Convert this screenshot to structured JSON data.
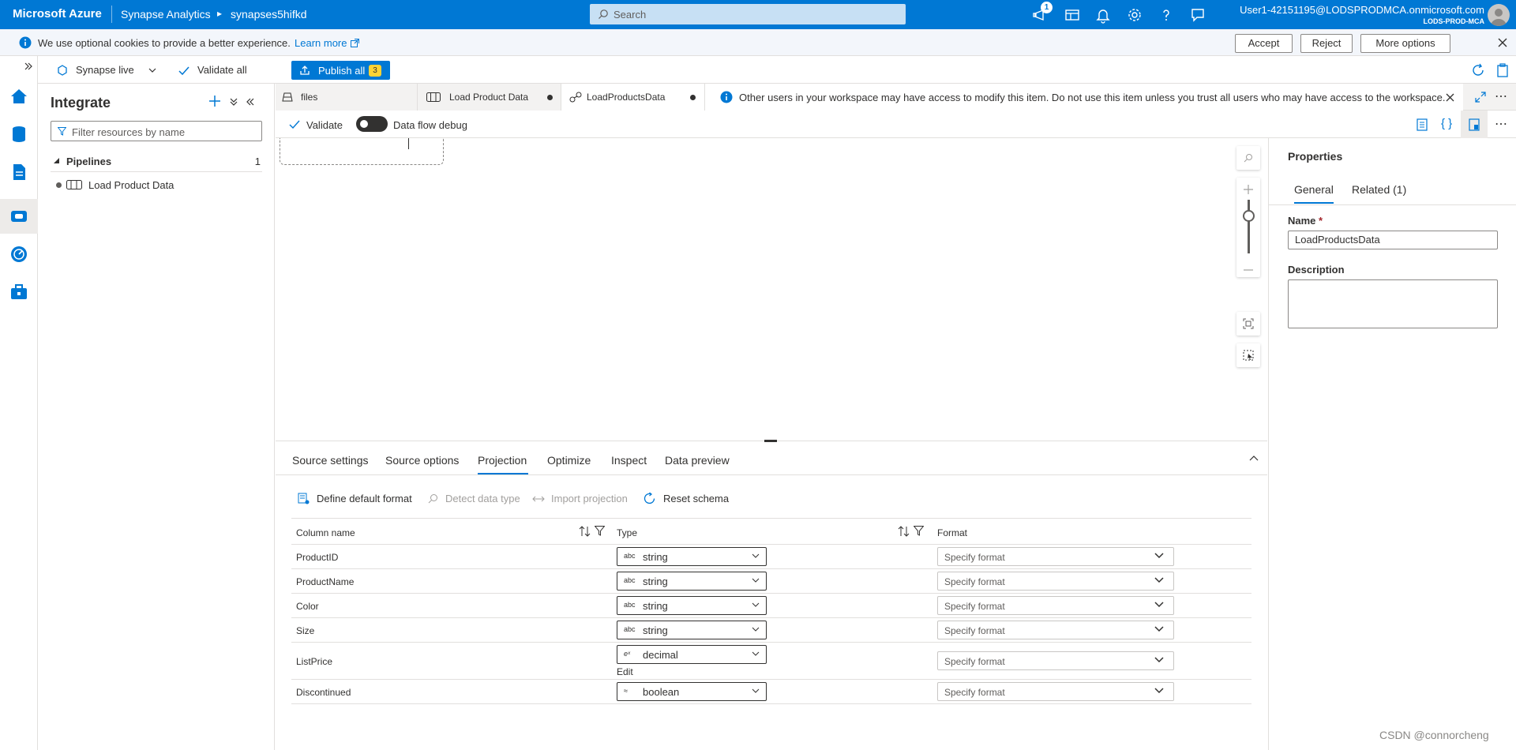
{
  "topbar": {
    "brand": "Microsoft Azure",
    "crumbs": [
      "Synapse Analytics",
      "synapses5hifkd"
    ],
    "search_placeholder": "Search",
    "notification_count": "1",
    "user_name": "User1-42151195@LODSPRODMCA.onmicrosoft.com",
    "user_tenant": "LODS-PROD-MCA"
  },
  "cookie": {
    "message": "We use optional cookies to provide a better experience.",
    "learn_more": "Learn more",
    "accept": "Accept",
    "reject": "Reject",
    "more_options": "More options"
  },
  "toolbar": {
    "synapse_live": "Synapse live",
    "validate_all": "Validate all",
    "publish_all": "Publish all",
    "publish_count": "3"
  },
  "integrate": {
    "title": "Integrate",
    "filter_placeholder": "Filter resources by name",
    "pipelines_label": "Pipelines",
    "pipelines_count": "1",
    "pipeline_item": "Load Product Data"
  },
  "tabs": {
    "files": "files",
    "load_product_data": "Load Product Data",
    "load_products_data": "LoadProductsData",
    "banner": "Other users in your workspace may have access to modify this item. Do not use this item unless you trust all users who may have access to the workspace."
  },
  "editor": {
    "validate": "Validate",
    "debug": "Data flow debug"
  },
  "properties": {
    "title": "Properties",
    "tab_general": "General",
    "tab_related": "Related (1)",
    "name_label": "Name",
    "required_mark": "*",
    "name_value": "LoadProductsData",
    "description_label": "Description"
  },
  "bottom": {
    "tabs": [
      "Source settings",
      "Source options",
      "Projection",
      "Optimize",
      "Inspect",
      "Data preview"
    ],
    "actions": {
      "define_default_format": "Define default format",
      "detect_data_type": "Detect data type",
      "import_projection": "Import projection",
      "reset_schema": "Reset schema"
    },
    "headers": {
      "column_name": "Column name",
      "type": "Type",
      "format": "Format"
    },
    "format_placeholder": "Specify format",
    "edit_link": "Edit",
    "rows": [
      {
        "name": "ProductID",
        "type_icon": "abc",
        "type": "string"
      },
      {
        "name": "ProductName",
        "type_icon": "abc",
        "type": "string"
      },
      {
        "name": "Color",
        "type_icon": "abc",
        "type": "string"
      },
      {
        "name": "Size",
        "type_icon": "abc",
        "type": "string"
      },
      {
        "name": "ListPrice",
        "type_icon": "eˣ",
        "type": "decimal"
      },
      {
        "name": "Discontinued",
        "type_icon": "≈",
        "type": "boolean"
      }
    ]
  },
  "watermark": "CSDN @connorcheng",
  "colors": {
    "accent": "#0078d4",
    "badge": "#ffd335"
  }
}
